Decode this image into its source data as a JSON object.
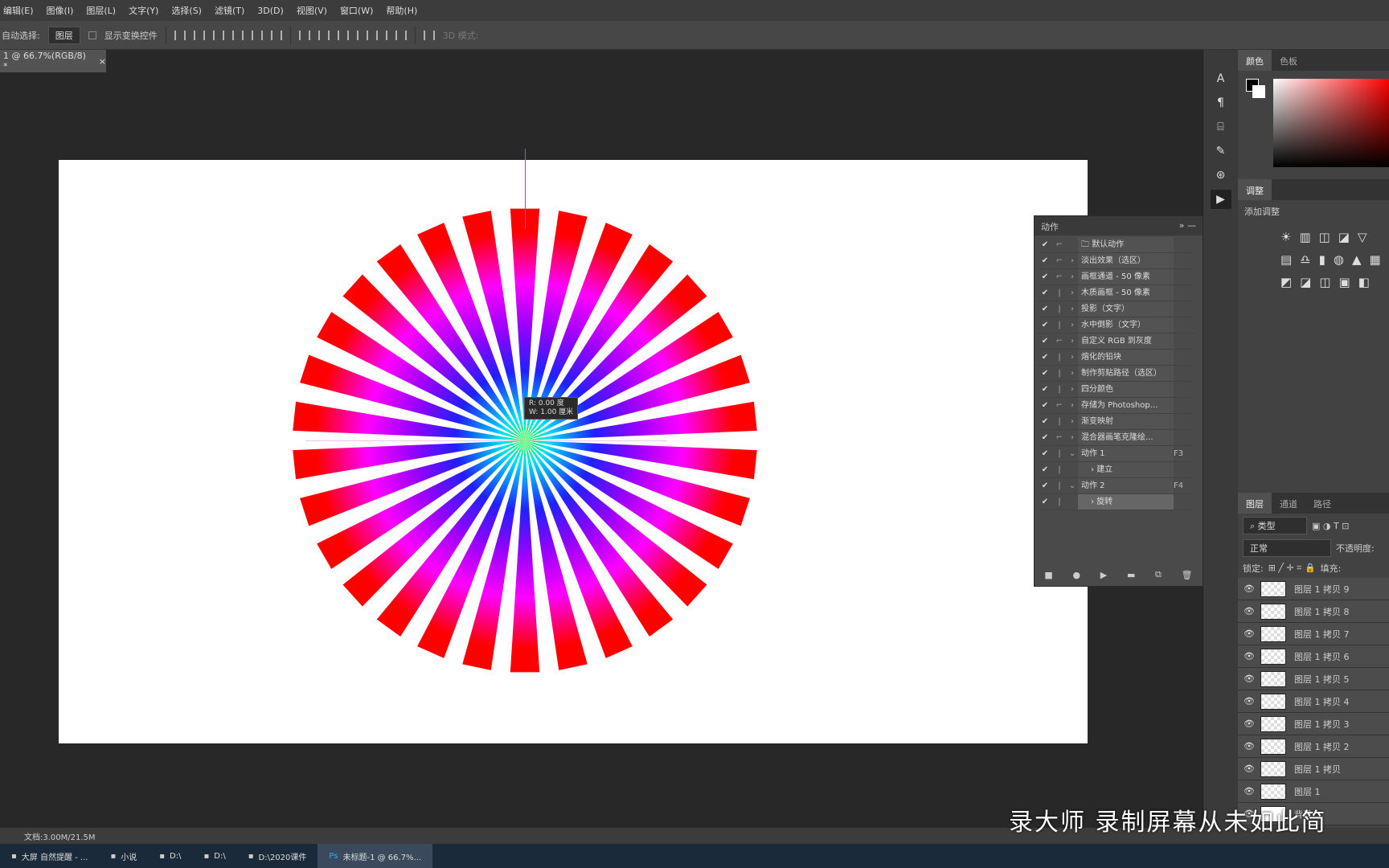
{
  "menu": [
    "编辑(E)",
    "图像(I)",
    "图层(L)",
    "文字(Y)",
    "选择(S)",
    "滤镜(T)",
    "3D(D)",
    "视图(V)",
    "窗口(W)",
    "帮助(H)"
  ],
  "options": {
    "auto_select_label": "自动选择:",
    "auto_select_value": "图层",
    "transform_label": "显示变换控件",
    "mode_3d": "3D 模式:"
  },
  "doc_tab": {
    "title": "1 @ 66.7%(RGB/8) *",
    "close": "×"
  },
  "tooltip": {
    "line1": "R: 0.00 度",
    "line2": "W: 1.00 厘米"
  },
  "starburst": {
    "rays": 30,
    "colors": [
      "#22ff22",
      "#00e0ff",
      "#2020ff",
      "#a000ff",
      "#ff00ff",
      "#ff0000"
    ]
  },
  "color_panel": {
    "tabs": [
      "颜色",
      "色板"
    ]
  },
  "adjust_panel": {
    "tabs": [
      "调整"
    ],
    "subtitle": "添加调整"
  },
  "actions_panel": {
    "title": "动作",
    "rows": [
      {
        "label": "默认动作",
        "folder": true,
        "expanded": true,
        "key": ""
      },
      {
        "label": "淡出效果（选区）",
        "key": ""
      },
      {
        "label": "画框通道 - 50 像素",
        "key": ""
      },
      {
        "label": "木质画框 - 50 像素",
        "key": ""
      },
      {
        "label": "投影（文字）",
        "key": ""
      },
      {
        "label": "水中倒影（文字）",
        "key": ""
      },
      {
        "label": "自定义 RGB 到灰度",
        "key": ""
      },
      {
        "label": "熔化的铅块",
        "key": ""
      },
      {
        "label": "制作剪贴路径（选区）",
        "key": ""
      },
      {
        "label": "四分颜色",
        "key": ""
      },
      {
        "label": "存储为 Photoshop...",
        "key": ""
      },
      {
        "label": "渐变映射",
        "key": ""
      },
      {
        "label": "混合器画笔克隆绘...",
        "key": ""
      },
      {
        "label": "动作 1",
        "key": "F3",
        "expanded": true
      },
      {
        "label": "建立",
        "key": "",
        "indent": true
      },
      {
        "label": "动作 2",
        "key": "F4",
        "expanded": true
      },
      {
        "label": "旋转",
        "key": "",
        "indent": true,
        "selected": true
      }
    ]
  },
  "layers_panel": {
    "tabs": [
      "图层",
      "通道",
      "路径"
    ],
    "filter": "类型",
    "blend": "正常",
    "opacity_label": "不透明度:",
    "lock_label": "锁定:",
    "fill_label": "填充:",
    "layers": [
      "图层 1 拷贝 9",
      "图层 1 拷贝 8",
      "图层 1 拷贝 7",
      "图层 1 拷贝 6",
      "图层 1 拷贝 5",
      "图层 1 拷贝 4",
      "图层 1 拷贝 3",
      "图层 1 拷贝 2",
      "图层 1 拷贝",
      "图层 1",
      "背景"
    ]
  },
  "status": "文档:3.00M/21.5M",
  "taskbar": [
    {
      "label": "大屏 自然提醒 - ...",
      "active": false
    },
    {
      "label": "小说",
      "active": false
    },
    {
      "label": "D:\\",
      "active": false
    },
    {
      "label": "D:\\",
      "active": false
    },
    {
      "label": "D:\\2020课件",
      "active": false
    },
    {
      "label": "未标题-1 @ 66.7%...",
      "active": true
    }
  ],
  "watermark": "录大师 录制屏幕从未如此简"
}
